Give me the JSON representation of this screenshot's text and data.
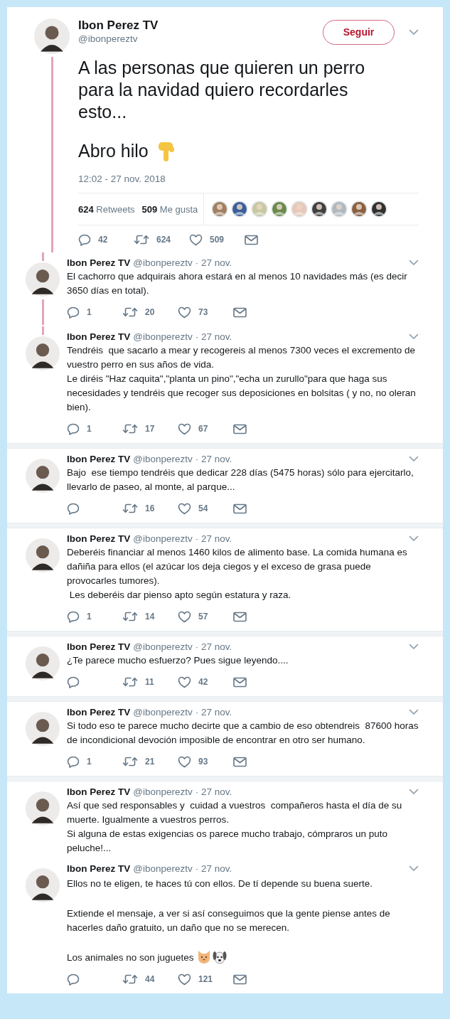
{
  "main_tweet": {
    "name": "Ibon Perez TV",
    "handle": "@ibonpereztv",
    "follow_button": "Seguir",
    "paragraphs": [
      "A las personas que quieren un perro para la navidad quiero recordarles esto...",
      "Abro hilo"
    ],
    "timestamp": "12:02 - 27 nov. 2018",
    "stats": [
      {
        "count": "624",
        "label": "Retweets"
      },
      {
        "count": "509",
        "label": "Me gusta"
      }
    ],
    "liker_avatars": [
      {
        "kind": "picture",
        "color": "#a08060"
      },
      {
        "kind": "picture",
        "color": "#3a5f9a"
      },
      {
        "kind": "picture",
        "color": "#c8c8a0"
      },
      {
        "kind": "picture",
        "color": "#6a8a4a"
      },
      {
        "kind": "picture",
        "color": "#e8c8b8"
      },
      {
        "kind": "picture",
        "color": "#404040"
      },
      {
        "kind": "picture",
        "color": "#b0b8c0"
      },
      {
        "kind": "picture",
        "color": "#8a6040"
      },
      {
        "kind": "picture",
        "color": "#303030"
      }
    ],
    "actions": {
      "reply": "42",
      "retweet": "624",
      "like": "509"
    }
  },
  "replies": [
    {
      "name": "Ibon Perez TV",
      "handle": "@ibonpereztv",
      "date": "· 27 nov.",
      "divider_above": false,
      "thread_above": true,
      "thread_below": true,
      "text": "El cachorro que adquirais ahora estará en al menos 10 navidades más (es decir 3650 días en total).",
      "actions": {
        "reply": "1",
        "retweet": "20",
        "like": "73"
      }
    },
    {
      "name": "Ibon Perez TV",
      "handle": "@ibonpereztv",
      "date": "· 27 nov.",
      "divider_above": false,
      "thread_above": true,
      "thread_below": false,
      "text": "Tendréis  que sacarlo a mear y recogereis al menos 7300 veces el excremento de vuestro perro en sus años de vida.\nLe diréis \"Haz caquita\",\"planta un pino\",\"echa un zurullo\"para que haga sus necesidades y tendréis que recoger sus deposiciones en bolsitas ( y no, no oleran bien).",
      "actions": {
        "reply": "1",
        "retweet": "17",
        "like": "67"
      }
    },
    {
      "name": "Ibon Perez TV",
      "handle": "@ibonpereztv",
      "date": "· 27 nov.",
      "divider_above": true,
      "thread_above": false,
      "thread_below": false,
      "text": "Bajo  ese tiempo tendréis que dedicar 228 días (5475 horas) sólo para ejercitarlo, llevarlo de paseo, al monte, al parque...",
      "actions": {
        "retweet": "16",
        "like": "54"
      }
    },
    {
      "name": "Ibon Perez TV",
      "handle": "@ibonpereztv",
      "date": "· 27 nov.",
      "divider_above": true,
      "thread_above": false,
      "thread_below": false,
      "text": "Deberéis financiar al menos 1460 kilos de alimento base. La comida humana es dañiña para ellos (el azúcar los deja ciegos y el exceso de grasa puede provocarles tumores).\n Les deberéis dar pienso apto según estatura y raza.",
      "actions": {
        "reply": "1",
        "retweet": "14",
        "like": "57"
      }
    },
    {
      "name": "Ibon Perez TV",
      "handle": "@ibonpereztv",
      "date": "· 27 nov.",
      "divider_above": true,
      "thread_above": false,
      "thread_below": false,
      "text": "¿Te parece mucho esfuerzo? Pues sigue leyendo....",
      "actions": {
        "retweet": "11",
        "like": "42"
      }
    },
    {
      "name": "Ibon Perez TV",
      "handle": "@ibonpereztv",
      "date": "· 27 nov.",
      "divider_above": true,
      "thread_above": false,
      "thread_below": false,
      "text": "Si todo eso te parece mucho decirte que a cambio de eso obtendreis  87600 horas de incondicional devoción imposible de encontrar en otro ser humano.",
      "actions": {
        "reply": "1",
        "retweet": "21",
        "like": "93"
      }
    },
    {
      "name": "Ibon Perez TV",
      "handle": "@ibonpereztv",
      "date": "· 27 nov.",
      "divider_above": true,
      "thread_above": false,
      "thread_below": false,
      "text": "Así que sed responsables y  cuidad a vuestros  compañeros hasta el día de su muerte. Igualmente a vuestros perros.\nSi alguna de estas exigencias os parece mucho trabajo, cómpraros un puto peluche!..."
    },
    {
      "name": "Ibon Perez TV",
      "handle": "@ibonpereztv",
      "date": "· 27 nov.",
      "divider_above": false,
      "thread_above": false,
      "thread_below": false,
      "paragraphs": [
        "Ellos no te eligen, te haces tú con ellos. De tí depende su buena suerte.",
        "Extiende el mensaje, a ver si así conseguimos que la gente piense antes de hacerles daño gratuito, un daño que no se merecen.",
        "Los animales no son juguetes"
      ],
      "actions": {
        "retweet": "44",
        "like": "121"
      }
    }
  ]
}
